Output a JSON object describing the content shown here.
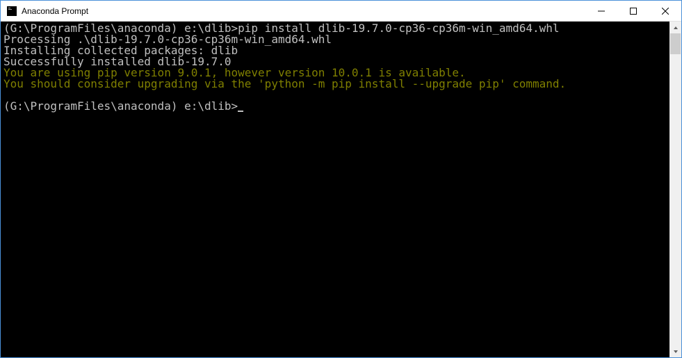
{
  "window": {
    "title": "Anaconda Prompt"
  },
  "terminal": {
    "lines": {
      "prompt1": "(G:\\ProgramFiles\\anaconda) e:\\dlib>pip install dlib-19.7.0-cp36-cp36m-win_amd64.whl",
      "processing": "Processing .\\dlib-19.7.0-cp36-cp36m-win_amd64.whl",
      "installing": "Installing collected packages: dlib",
      "success": "Successfully installed dlib-19.7.0",
      "warn1": "You are using pip version 9.0.1, however version 10.0.1 is available.",
      "warn2": "You should consider upgrading via the 'python -m pip install --upgrade pip' command.",
      "blank": "",
      "prompt2": "(G:\\ProgramFiles\\anaconda) e:\\dlib>"
    }
  }
}
